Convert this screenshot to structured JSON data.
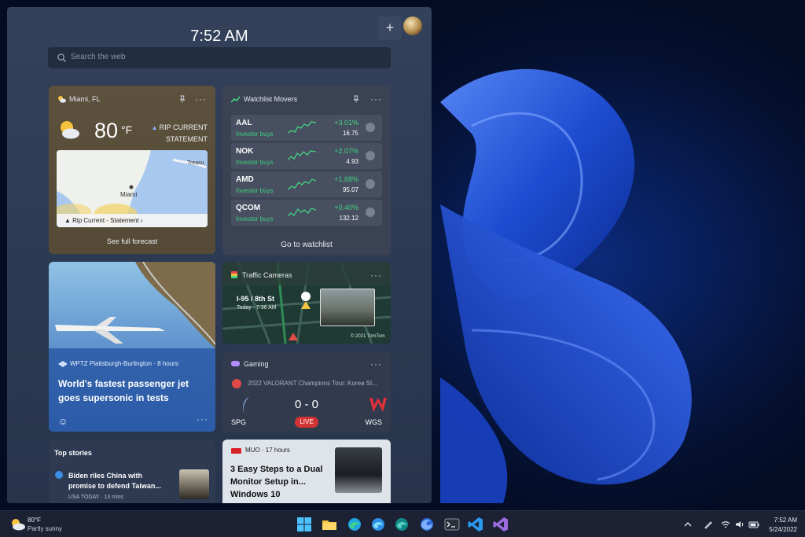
{
  "panel": {
    "time": "7:52 AM",
    "search_placeholder": "Search the web"
  },
  "weather": {
    "location": "Miami, FL",
    "temperature": "80",
    "unit": "°F",
    "alert_line1": "RIP CURRENT",
    "alert_line2": "STATEMENT",
    "map_city": "Miami",
    "map_place": "Treasu",
    "map_alert": "Rip Current - Statement",
    "link": "See full forecast"
  },
  "watchlist": {
    "title": "Watchlist Movers",
    "stocks": [
      {
        "ticker": "AAL",
        "label": "Investor buys",
        "change": "+3.01%",
        "price": "16.75"
      },
      {
        "ticker": "NOK",
        "label": "Investor buys",
        "change": "+2.07%",
        "price": "4.93"
      },
      {
        "ticker": "AMD",
        "label": "Investor buys",
        "change": "+1.68%",
        "price": "95.07"
      },
      {
        "ticker": "QCOM",
        "label": "Investor buys",
        "change": "+0.40%",
        "price": "132.12"
      }
    ],
    "link": "Go to watchlist"
  },
  "news": {
    "source": "WPTZ Plattsburgh-Burlington · 8 hours",
    "title": "World's fastest passenger jet goes supersonic in tests"
  },
  "traffic": {
    "title": "Traffic Cameras",
    "location": "I-95 / 8th St",
    "time": "Today · 7:36 AM",
    "copyright": "© 2021 TomTom"
  },
  "gaming": {
    "title": "Gaming",
    "match": "2022 VALORANT Champions Tour: Korea St...",
    "team_left": "SPG",
    "team_right": "WGS",
    "score": "0 - 0",
    "live": "LIVE"
  },
  "top_stories": {
    "title": "Top stories",
    "headline": "Biden riles China with promise to defend Taiwan...",
    "source": "USA TODAY · 13 mins"
  },
  "muo": {
    "source": "MUO · 17 hours",
    "headline": "3 Easy Steps to a Dual Monitor Setup in... Windows 10"
  },
  "taskbar": {
    "weather_temp": "80°F",
    "weather_desc": "Partly sunny",
    "time": "7:52 AM",
    "date": "5/24/2022",
    "apps": [
      "start-icon",
      "file-explorer-icon",
      "edge-icon",
      "edge-beta-icon",
      "edge-dev-icon",
      "firefox-icon",
      "terminal-icon",
      "vscode-icon",
      "visual-studio-icon"
    ]
  },
  "colors": {
    "gain_green": "#45d37f",
    "live_red": "#d43333",
    "panel_bg": "#2e3c55",
    "wallpaper_blue": "#1f4fd8"
  }
}
